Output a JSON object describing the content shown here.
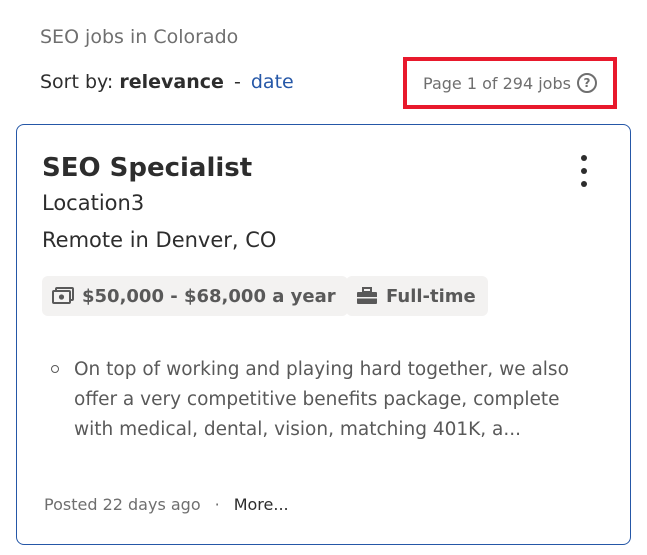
{
  "header": {
    "breadcrumb": "SEO jobs in Colorado",
    "sort_prefix": "Sort by:",
    "sort_active": "relevance",
    "sort_separator": "-",
    "sort_alternate": "date",
    "page_info": "Page 1 of 294 jobs",
    "help_icon": "?",
    "highlight_color": "#e8192c"
  },
  "job": {
    "title": "SEO Specialist",
    "company": "Location3",
    "location": "Remote in Denver, CO",
    "salary": "$50,000 - $68,000 a year",
    "salary_icon": "money-icon",
    "job_type": "Full-time",
    "job_type_icon": "briefcase-icon",
    "snippet": "On top of working and playing hard together, we also offer a very competitive benefits package, complete with medical, dental, vision, matching 401K, a...",
    "posted": "Posted 22 days ago",
    "separator": "·",
    "more_label": "More...",
    "card_border_color": "#2557a7"
  }
}
